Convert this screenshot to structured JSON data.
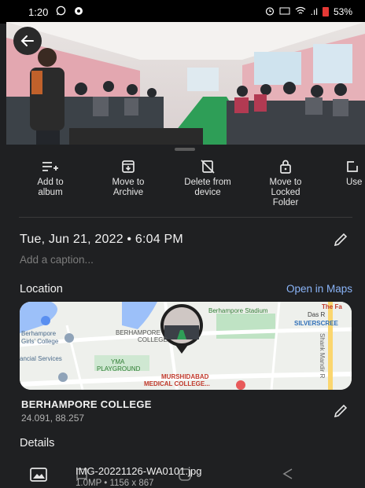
{
  "status": {
    "time": "1:20",
    "signal_text": ".ıl",
    "battery": "53%",
    "battery_color": "#e53935"
  },
  "photo": {
    "description_icon": "photo"
  },
  "actions": [
    {
      "label": "Add to\nalbum",
      "icon": "playlist-add-icon"
    },
    {
      "label": "Move to\nArchive",
      "icon": "archive-icon"
    },
    {
      "label": "Delete from\ndevice",
      "icon": "delete-from-device-icon"
    },
    {
      "label": "Move to\nLocked\nFolder",
      "icon": "lock-icon"
    },
    {
      "label": "Use",
      "icon": "use-as-icon"
    }
  ],
  "info": {
    "date": "Tue, Jun 21, 2022 • 6:04 PM",
    "caption_placeholder": "Add a caption..."
  },
  "location": {
    "title": "Location",
    "open_maps": "Open in Maps",
    "map_labels": {
      "stadium": "Berhampore Stadium",
      "the_fa": "The Fa",
      "silverscreen": "SILVERSCREE",
      "college_a": "BERHAMPORE",
      "college_b": "COLLEGE",
      "girls_college_1": "Berhampore",
      "girls_college_2": "Girls' College",
      "financial": "ancial Services",
      "yma_1": "YMA",
      "yma_2": "PLAYGROUND",
      "medical_1": "MURSHIDABAD",
      "medical_2": "MEDICAL COLLEGE...",
      "road": "Shank Mandir R",
      "das": "Das R"
    },
    "name": "BERHAMPORE COLLEGE",
    "coords": "24.091, 88.257"
  },
  "details": {
    "title": "Details",
    "file_name": "IMG-20221126-WA0101.jpg",
    "file_meta": "1.0MP • 1156 x 867"
  },
  "colors": {
    "background": "#1f2022",
    "accent_link": "#8ab4f8"
  }
}
